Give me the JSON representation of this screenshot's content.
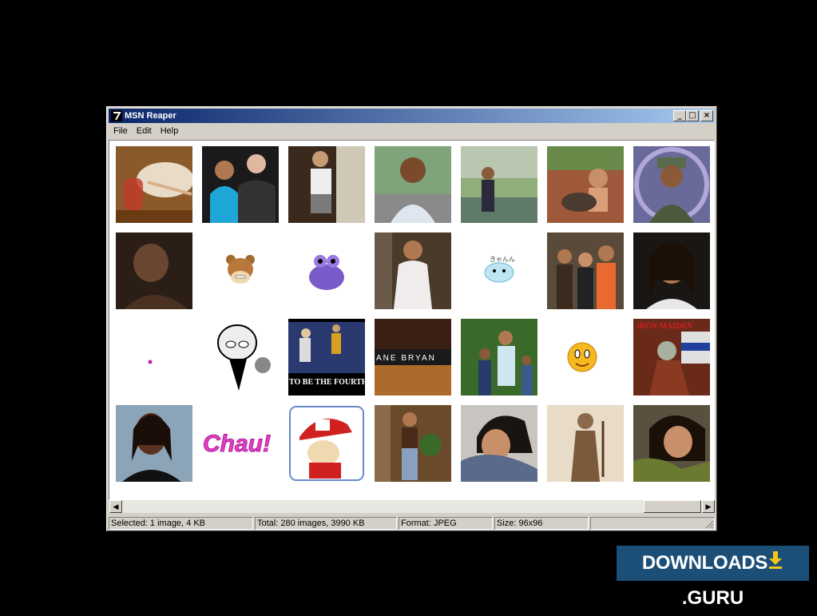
{
  "window": {
    "title": "MSN Reaper"
  },
  "title_buttons": {
    "minimize": "_",
    "maximize": "□",
    "close": "×"
  },
  "menu": [
    "File",
    "Edit",
    "Help"
  ],
  "thumbnails": [
    {
      "name": "food-photo"
    },
    {
      "name": "couple-photo"
    },
    {
      "name": "boy-photo"
    },
    {
      "name": "man-outdoor-photo"
    },
    {
      "name": "woman-park-photo"
    },
    {
      "name": "child-dog-photo"
    },
    {
      "name": "boy-cap-photo"
    },
    {
      "name": "woman-dark-photo"
    },
    {
      "name": "bear-emoticon"
    },
    {
      "name": "purple-creature-emoticon"
    },
    {
      "name": "woman-tree-photo"
    },
    {
      "name": "blue-blob-emoticon"
    },
    {
      "name": "family-photo"
    },
    {
      "name": "woman-night-photo"
    },
    {
      "name": "tiny-dot-image"
    },
    {
      "name": "cartoon-girl-image"
    },
    {
      "name": "kids-bleachers-photo"
    },
    {
      "name": "store-front-photo"
    },
    {
      "name": "family-garden-photo"
    },
    {
      "name": "smiley-emoticon"
    },
    {
      "name": "iron-maiden-image"
    },
    {
      "name": "woman-portrait-photo"
    },
    {
      "name": "chau-text-image"
    },
    {
      "name": "cartoon-kid-flag-image"
    },
    {
      "name": "woman-mall-photo"
    },
    {
      "name": "girl-thinking-photo"
    },
    {
      "name": "saint-statue-image"
    },
    {
      "name": "girl-pose-photo"
    }
  ],
  "image_text": {
    "kids_caption": "TO BE THE FOURTH",
    "store_sign": "ANE BRYAN",
    "band_logo": "IRON MAIDEN",
    "chau": "Chau!"
  },
  "status": {
    "selected": "Selected: 1 image, 4 KB",
    "total": "Total: 280 images, 3990 KB",
    "format": "Format: JPEG",
    "size": "Size: 96x96"
  },
  "watermark": {
    "left": "DOWNLOADS",
    "right": ".GURU"
  },
  "colors": {
    "title_start": "#0a246a",
    "title_end": "#a6caf0",
    "face": "#d4d0c8",
    "watermark_bg": "#1c4f78",
    "watermark_arrow": "#f5c518"
  }
}
